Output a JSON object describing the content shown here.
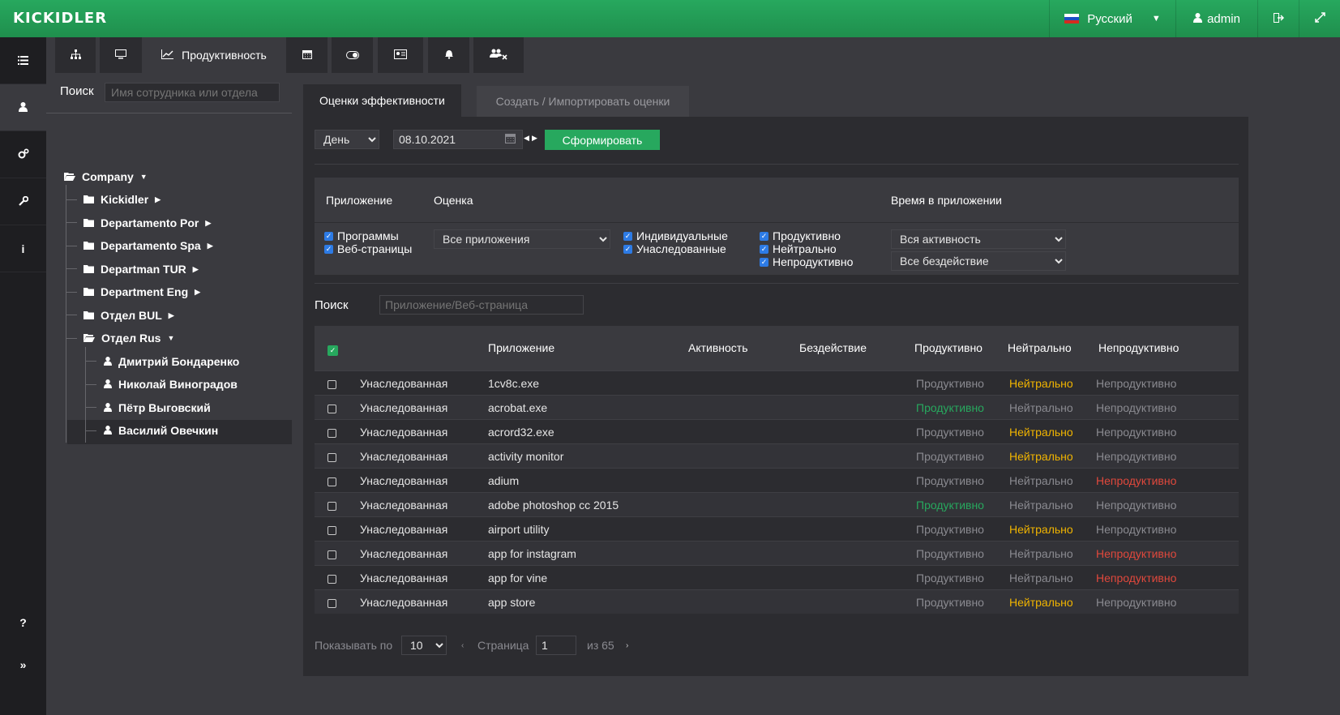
{
  "topbar": {
    "logo": "KICKIDLER",
    "language": "Русский",
    "user": "admin"
  },
  "sidebar": {
    "help": "?",
    "expand": "»"
  },
  "tabs": {
    "productivity": "Продуктивность"
  },
  "left": {
    "search_label": "Поиск",
    "search_placeholder": "Имя сотрудника или отдела",
    "tree": {
      "root": "Company",
      "departments": [
        "Kickidler",
        "Departamento Por",
        "Departamento Spa",
        "Departman TUR",
        "Department Eng",
        "Отдел BUL",
        "Отдел Rus"
      ],
      "employees": [
        "Дмитрий Бондаренко",
        "Николай Виноградов",
        "Пётр Выговский",
        "Василий Овечкин"
      ]
    }
  },
  "main": {
    "tab_active": "Оценки эффективности",
    "tab_inactive": "Создать / Импортировать оценки",
    "period": "День",
    "date": "08.10.2021",
    "generate": "Сформировать",
    "filters": {
      "head_app": "Приложение",
      "head_rating": "Оценка",
      "head_time": "Время в приложении",
      "programs": "Программы",
      "webpages": "Веб-страницы",
      "all_apps": "Все приложения",
      "individual": "Индивидуальные",
      "inherited": "Унаследованные",
      "productive": "Продуктивно",
      "neutral": "Нейтрально",
      "unproductive": "Непродуктивно",
      "all_activity": "Вся активность",
      "all_idle": "Все бездействие"
    },
    "search_label": "Поиск",
    "search_placeholder": "Приложение/Веб-страница",
    "table": {
      "headers": {
        "app": "Приложение",
        "activity": "Активность",
        "idle": "Бездействие",
        "productive": "Продуктивно",
        "neutral": "Нейтрально",
        "unproductive": "Непродуктивно"
      },
      "rows": [
        {
          "type": "Унаследованная",
          "app": "1cv8c.exe",
          "p": "Продуктивно",
          "n": "Нейтрально",
          "u": "Непродуктивно",
          "selected": "n"
        },
        {
          "type": "Унаследованная",
          "app": "acrobat.exe",
          "p": "Продуктивно",
          "n": "Нейтрально",
          "u": "Непродуктивно",
          "selected": "p"
        },
        {
          "type": "Унаследованная",
          "app": "acrord32.exe",
          "p": "Продуктивно",
          "n": "Нейтрально",
          "u": "Непродуктивно",
          "selected": "n"
        },
        {
          "type": "Унаследованная",
          "app": "activity monitor",
          "p": "Продуктивно",
          "n": "Нейтрально",
          "u": "Непродуктивно",
          "selected": "n"
        },
        {
          "type": "Унаследованная",
          "app": "adium",
          "p": "Продуктивно",
          "n": "Нейтрально",
          "u": "Непродуктивно",
          "selected": "u"
        },
        {
          "type": "Унаследованная",
          "app": "adobe photoshop cc 2015",
          "p": "Продуктивно",
          "n": "Нейтрально",
          "u": "Непродуктивно",
          "selected": "p"
        },
        {
          "type": "Унаследованная",
          "app": "airport utility",
          "p": "Продуктивно",
          "n": "Нейтрально",
          "u": "Непродуктивно",
          "selected": "n"
        },
        {
          "type": "Унаследованная",
          "app": "app for instagram",
          "p": "Продуктивно",
          "n": "Нейтрально",
          "u": "Непродуктивно",
          "selected": "u"
        },
        {
          "type": "Унаследованная",
          "app": "app for vine",
          "p": "Продуктивно",
          "n": "Нейтрально",
          "u": "Непродуктивно",
          "selected": "u"
        },
        {
          "type": "Унаследованная",
          "app": "app store",
          "p": "Продуктивно",
          "n": "Нейтрально",
          "u": "Непродуктивно",
          "selected": "n"
        }
      ]
    },
    "pager": {
      "show_by": "Показывать по",
      "per_page": "10",
      "page_label": "Страница",
      "page": "1",
      "of": "из 65"
    }
  },
  "colors": {
    "brand": "#27a85e",
    "neutral": "#f0b400",
    "unproductive": "#e0483c",
    "sidebar": "#1e1e21"
  }
}
